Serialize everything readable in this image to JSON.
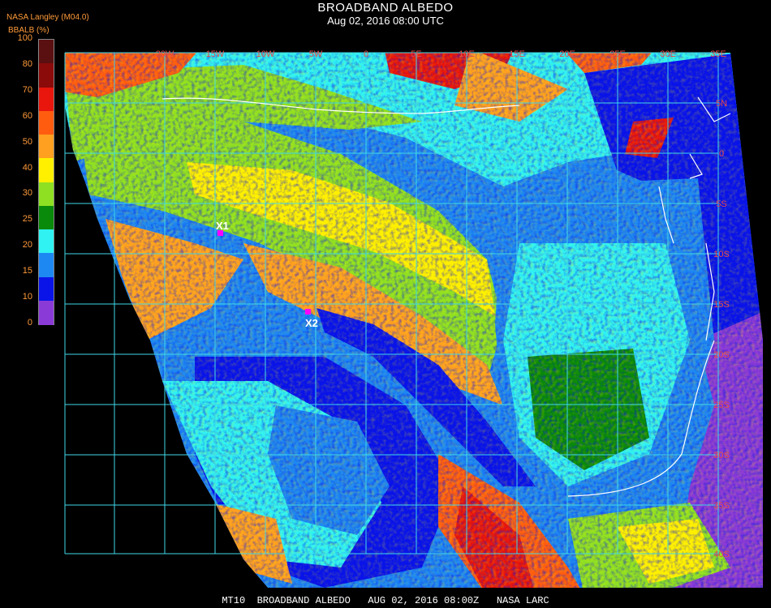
{
  "header": {
    "title": "BROADBAND ALBEDO",
    "datetime": "Aug 02, 2016 08:00 UTC",
    "source": "NASA Langley (M04.0)"
  },
  "legend": {
    "label": "BBALB (%)",
    "ticks": [
      "100",
      "80",
      "70",
      "60",
      "50",
      "40",
      "30",
      "25",
      "20",
      "15",
      "10",
      "0"
    ],
    "bands": [
      {
        "color": "#5a1010"
      },
      {
        "color": "#8b0a0a"
      },
      {
        "color": "#e8160c"
      },
      {
        "color": "#ff5c10"
      },
      {
        "color": "#ffa020"
      },
      {
        "color": "#fff000"
      },
      {
        "color": "#8fe022"
      },
      {
        "color": "#0a8a0a"
      },
      {
        "color": "#30f2f2"
      },
      {
        "color": "#1e88f2"
      },
      {
        "color": "#0a14e8"
      },
      {
        "color": "#8a3ad6"
      }
    ]
  },
  "map": {
    "top_longitude_labels": [
      "20W",
      "15W",
      "10W",
      "5W",
      "0",
      "5E",
      "10E",
      "15E",
      "20E",
      "25E",
      "30E",
      "35E"
    ],
    "right_latitude_labels": [
      "5N",
      "0",
      "5S",
      "10S",
      "15S",
      "20S",
      "25S",
      "30S",
      "35S",
      "40S"
    ],
    "markers": [
      {
        "label": "X1"
      },
      {
        "label": "X2"
      }
    ]
  },
  "footer": "MT10  BROADBAND ALBEDO   AUG 02, 2016 08:00Z   NASA LARC",
  "colors": {
    "grid": "#3fd8e8",
    "coast": "#ffffff",
    "label_orange": "#ff9a3a",
    "marker_magenta": "#ff00ff",
    "ocean_sky": "#1e88f2",
    "cloud_cyan": "#30f2f2"
  }
}
